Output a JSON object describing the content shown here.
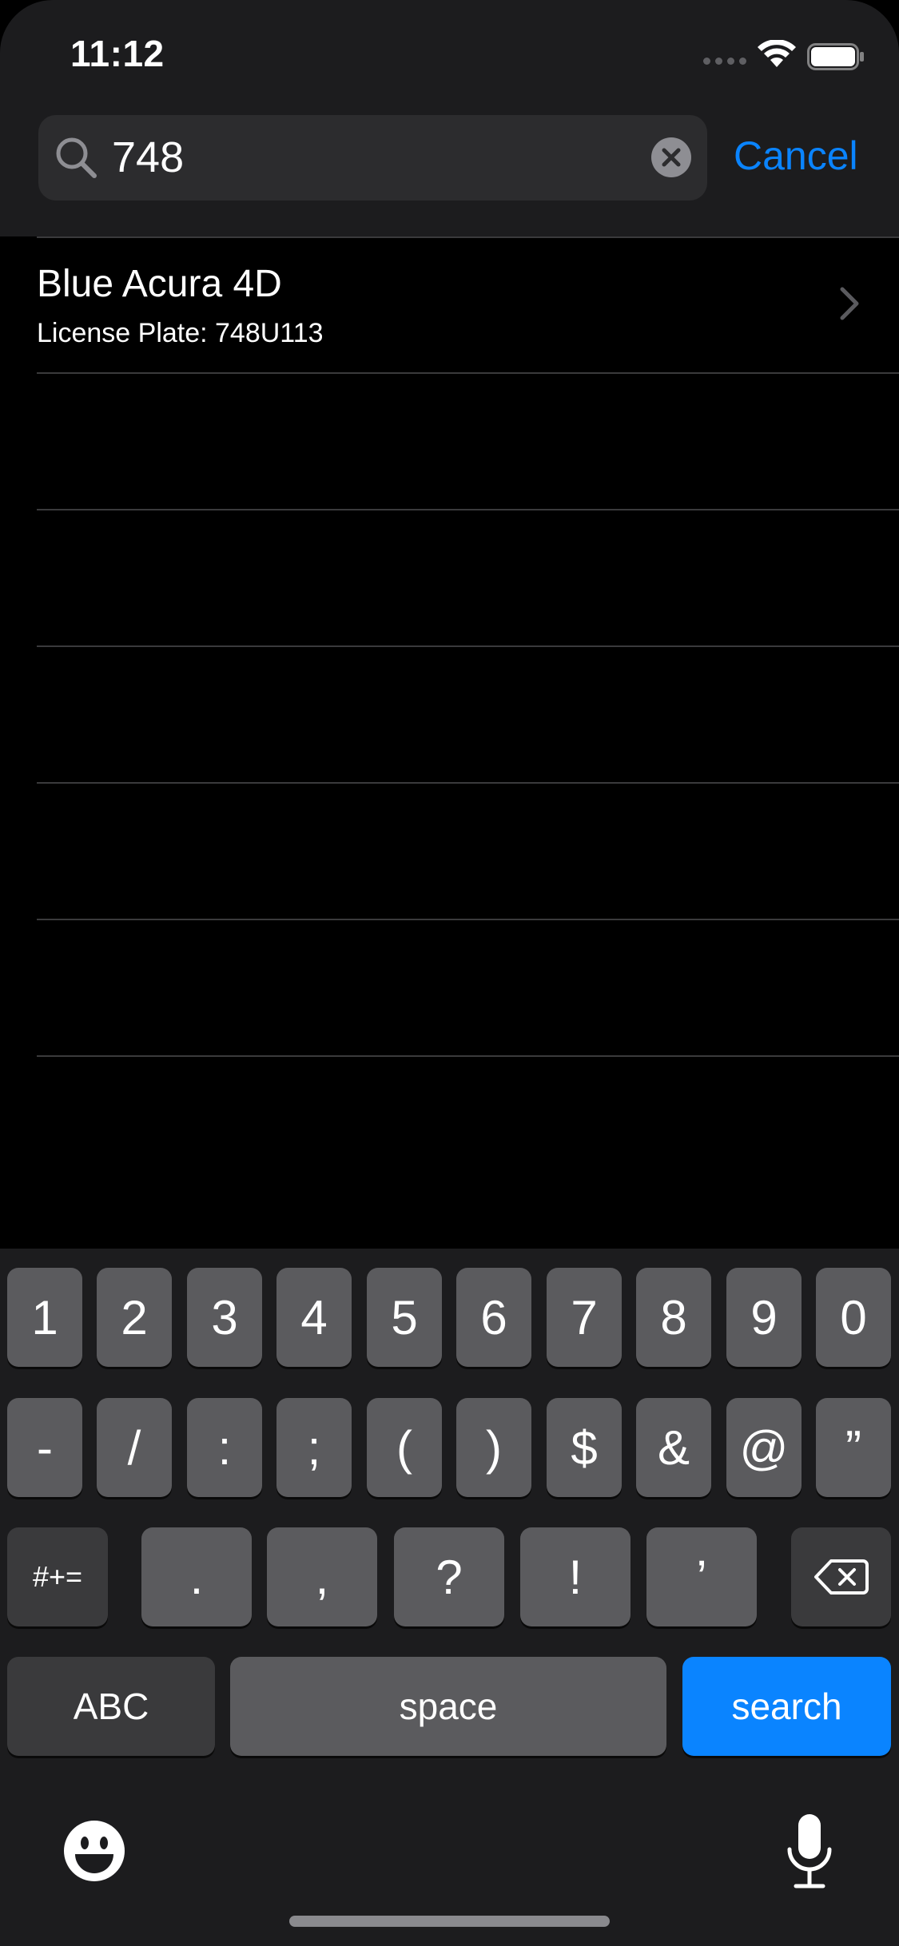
{
  "status_bar": {
    "time": "11:12"
  },
  "search": {
    "query": "748",
    "cancel_label": "Cancel"
  },
  "results": [
    {
      "title": "Blue Acura 4D",
      "subtitle": "License Plate: 748U113"
    }
  ],
  "keyboard": {
    "row1": [
      "1",
      "2",
      "3",
      "4",
      "5",
      "6",
      "7",
      "8",
      "9",
      "0"
    ],
    "row2": [
      "-",
      "/",
      ":",
      ";",
      "(",
      ")",
      "$",
      "&",
      "@",
      "”"
    ],
    "row3": {
      "symbols_toggle": "#+=",
      "keys": [
        ".",
        ",",
        "?",
        "!",
        "’"
      ]
    },
    "row4": {
      "abc": "ABC",
      "space": "space",
      "search": "search"
    }
  },
  "colors": {
    "accent": "#0a84ff",
    "background": "#000000",
    "header": "#1c1c1e",
    "key": "#5b5b5e",
    "key_dark": "#3a3a3c"
  },
  "icons": [
    "search-icon",
    "clear-icon",
    "chevron-right-icon",
    "wifi-icon",
    "battery-icon",
    "signal-icon",
    "backspace-icon",
    "emoji-icon",
    "microphone-icon"
  ]
}
